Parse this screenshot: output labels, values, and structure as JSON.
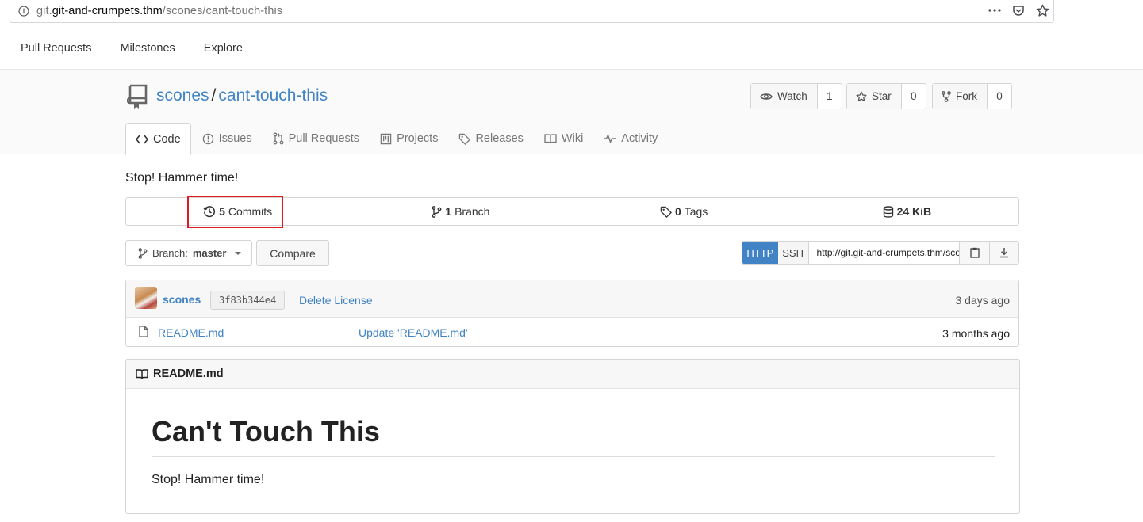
{
  "browser": {
    "url_prefix": "git.",
    "url_domain": "git-and-crumpets.thm",
    "url_path": "/scones/cant-touch-this"
  },
  "topnav": {
    "items": [
      "Pull Requests",
      "Milestones",
      "Explore"
    ]
  },
  "repo": {
    "owner": "scones",
    "separator": "/",
    "name": "cant-touch-this",
    "description": "Stop! Hammer time!",
    "watch_label": "Watch",
    "watch_count": "1",
    "star_label": "Star",
    "star_count": "0",
    "fork_label": "Fork",
    "fork_count": "0"
  },
  "tabs": [
    {
      "label": "Code",
      "icon": "code-icon"
    },
    {
      "label": "Issues",
      "icon": "issue-icon"
    },
    {
      "label": "Pull Requests",
      "icon": "pull-request-icon"
    },
    {
      "label": "Projects",
      "icon": "project-icon"
    },
    {
      "label": "Releases",
      "icon": "tag-icon"
    },
    {
      "label": "Wiki",
      "icon": "book-icon"
    },
    {
      "label": "Activity",
      "icon": "pulse-icon"
    }
  ],
  "stats": {
    "commits_count": "5",
    "commits_label": "Commits",
    "branch_count": "1",
    "branch_label": "Branch",
    "tags_count": "0",
    "tags_label": "Tags",
    "size": "24 KiB"
  },
  "toolbar": {
    "branch_prefix": "Branch:",
    "branch_name": "master",
    "compare_label": "Compare",
    "http_label": "HTTP",
    "ssh_label": "SSH",
    "clone_url": "http://git.git-and-crumpets.thm/scones/cant-touch-this.git"
  },
  "latest_commit": {
    "author": "scones",
    "sha": "3f83b344e4",
    "message": "Delete License",
    "time": "3 days ago"
  },
  "files": [
    {
      "name": "README.md",
      "commit": "Update 'README.md'",
      "time": "3 months ago"
    }
  ],
  "readme": {
    "filename": "README.md",
    "title": "Can't Touch This",
    "body": "Stop! Hammer time!"
  },
  "colors": {
    "link": "#4183c4",
    "highlight_box": "#e01b1b",
    "http_active": "#4183c4"
  }
}
